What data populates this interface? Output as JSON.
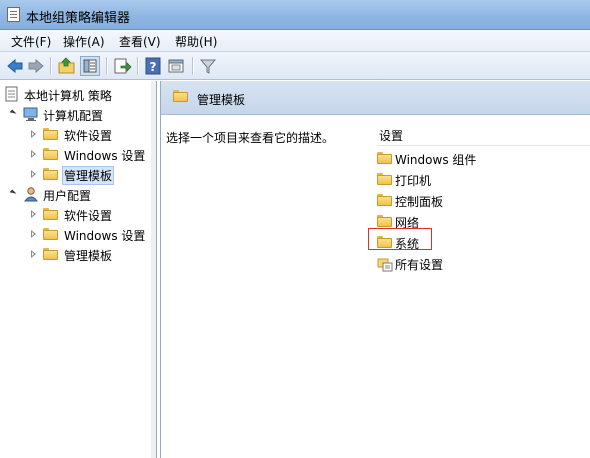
{
  "window": {
    "title": "本地组策略编辑器"
  },
  "menu": {
    "items": [
      "文件(F)",
      "操作(A)",
      "查看(V)",
      "帮助(H)"
    ]
  },
  "toolbar": {
    "buttons": [
      "back-icon",
      "forward-icon",
      "up-folder-icon",
      "show-hide-tree-icon",
      "export-list-icon",
      "help-icon",
      "properties-icon",
      "filter-icon"
    ]
  },
  "tree": {
    "root": "本地计算机 策略",
    "computer_config": "计算机配置",
    "user_config": "用户配置",
    "software": "软件设置",
    "windows": "Windows 设置",
    "admin": "管理模板"
  },
  "right": {
    "header": "管理模板",
    "description": "选择一个项目来查看它的描述。",
    "column_header": "设置",
    "items": [
      {
        "label": "Windows 组件",
        "icon": "folder-icon"
      },
      {
        "label": "打印机",
        "icon": "folder-icon"
      },
      {
        "label": "控制面板",
        "icon": "folder-icon"
      },
      {
        "label": "网络",
        "icon": "folder-icon"
      },
      {
        "label": "系统",
        "icon": "folder-icon"
      },
      {
        "label": "所有设置",
        "icon": "all-settings-icon"
      }
    ]
  },
  "colors": {
    "highlight_border": "#d9302a",
    "selection": "#d5e5f7"
  }
}
